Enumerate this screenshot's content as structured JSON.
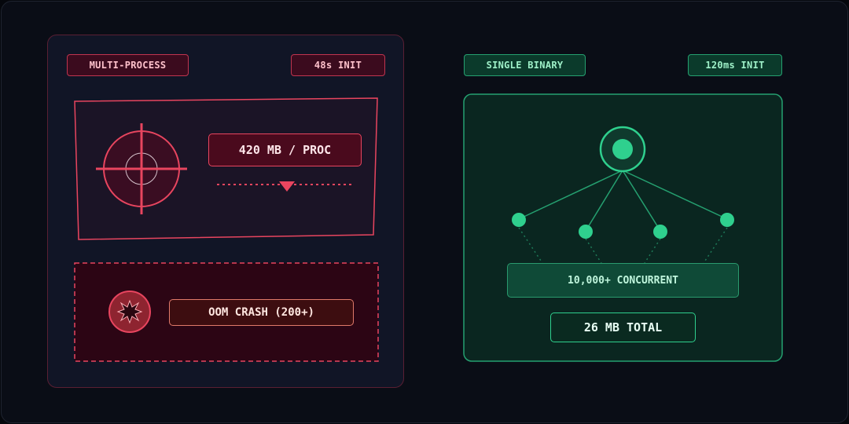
{
  "left": {
    "mode_tag": "MULTI-PROCESS",
    "init_tag": "48s INIT",
    "memory_label": "420 MB / PROC",
    "crash_label": "OOM CRASH (200+)",
    "accent_color": "#e8455f"
  },
  "right": {
    "mode_tag": "SINGLE BINARY",
    "init_tag": "120ms INIT",
    "concurrency_label": "10,000+ CONCURRENT",
    "total_label": "26 MB TOTAL",
    "accent_color": "#2fd08e"
  },
  "icons": [
    "crosshair-icon",
    "explosion-icon",
    "hub-node-icon"
  ]
}
